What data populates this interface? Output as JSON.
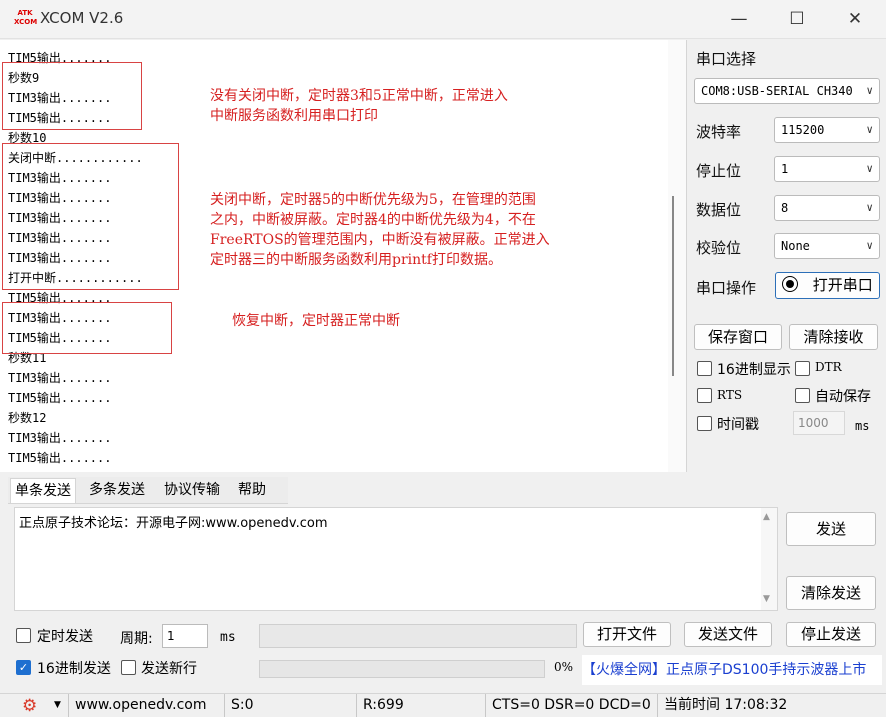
{
  "window": {
    "title": "XCOM V2.6",
    "logo_text_1": "ATK",
    "logo_text_2": "XCOM",
    "minimize": "—",
    "maximize": "☐",
    "close": "✕"
  },
  "receive": {
    "lines": [
      "TIM5输出.......",
      "秒数9",
      "TIM3输出.......",
      "TIM5输出.......",
      "秒数10",
      "关闭中断............",
      "TIM3输出.......",
      "TIM3输出.......",
      "TIM3输出.......",
      "TIM3输出.......",
      "TIM3输出.......",
      "打开中断............",
      "TIM5输出.......",
      "TIM3输出.......",
      "TIM5输出.......",
      "秒数11",
      "TIM3输出.......",
      "TIM5输出.......",
      "秒数12",
      "TIM3输出.......",
      "TIM5输出......."
    ],
    "note_1_line_1": "没有关闭中断，定时器3和5正常中断，正常进入",
    "note_1_line_2": "中断服务函数利用串口打印",
    "note_2_line_1": "关闭中断，定时器5的中断优先级为5，在管理的范围",
    "note_2_line_2": "之内，中断被屏蔽。定时器4的中断优先级为4，不在",
    "note_2_line_3": "FreeRTOS的管理范围内，中断没有被屏蔽。正常进入",
    "note_2_line_4": "定时器三的中断服务函数利用printf打印数据。",
    "note_3": "恢复中断，定时器正常中断"
  },
  "settings": {
    "port_select_label": "串口选择",
    "port_value": "COM8:USB-SERIAL CH340",
    "baud_label": "波特率",
    "baud_value": "115200",
    "stop_label": "停止位",
    "stop_value": "1",
    "data_label": "数据位",
    "data_value": "8",
    "parity_label": "校验位",
    "parity_value": "None",
    "port_op_label": "串口操作",
    "open_port_button": "打开串口",
    "save_window_button": "保存窗口",
    "clear_receive_button": "清除接收",
    "hex_display_label": "16进制显示",
    "dtr_label": "DTR",
    "rts_label": "RTS",
    "auto_save_label": "自动保存",
    "timestamp_label": "时间戳",
    "timestamp_value": "1000",
    "timestamp_unit": "ms"
  },
  "tabs": [
    "单条发送",
    "多条发送",
    "协议传输",
    "帮助"
  ],
  "send": {
    "text": "正点原子技术论坛：开源电子网:www.openedv.com",
    "send_button": "发送",
    "clear_send_button": "清除发送",
    "timed_send_label": "定时发送",
    "period_label": "周期:",
    "period_value": "1",
    "period_unit": "ms",
    "open_file_button": "打开文件",
    "send_file_button": "发送文件",
    "stop_send_button": "停止发送",
    "hex_send_label": "16进制发送",
    "send_newline_label": "发送新行",
    "progress_text": "0%",
    "progress": 0,
    "ad_bracket": "【火爆全网】",
    "ad_text": "正点原子DS100手持示波器上市"
  },
  "status": {
    "website": "www.openedv.com",
    "sent": "S:0",
    "received": "R:699",
    "lines": "CTS=0 DSR=0 DCD=0",
    "time": "当前时间 17:08:32"
  },
  "colors": {
    "accent": "#1e6fd0",
    "annotation": "#d62020",
    "ad_blue": "#1a3fd0"
  }
}
